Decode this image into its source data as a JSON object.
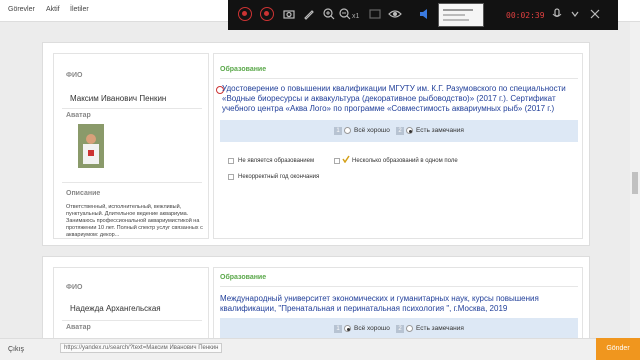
{
  "nav": {
    "tabs": [
      "Görevler",
      "Aktif",
      "İletiler"
    ]
  },
  "recorder": {
    "zoom_label": "x1",
    "timer": "00:02:39"
  },
  "cards": [
    {
      "fio_label": "ФИО",
      "name": "Максим Иванович Пенкин",
      "avatar_label": "Аватар",
      "desc_label": "Описание",
      "description": "Ответственный, исполнительный, вежливый, пунктуальный. Длительное ведение аквариума. Занимаюсь профессиональной аквариумистикой на протяжении 10 лет. Полный спектр услуг связанных с аквариумом: декор...",
      "edu_label": "Образование",
      "edu_text": "Удостоверение о повышении квалификации МГУТУ им. К.Г. Разумовского по специальности «Водные биоресурсы и аквакультура (декоративное рыбоводство)» (2017 г.). Сертификат учебного центра «Аква Лого» по программе «Совместимость аквариумных рыб» (2017 г.)",
      "opt1_num": "1",
      "opt1": "Всё хорошо",
      "opt2_num": "2",
      "opt2": "Есть замечания",
      "cb1": "Не является образованием",
      "cb2": "Несколько образований в одном поле",
      "cb3": "Некорректный год окончания"
    },
    {
      "fio_label": "ФИО",
      "name": "Надежда Архангельская",
      "avatar_label": "Аватар",
      "edu_label": "Образование",
      "edu_text": "Международный университет экономических и гуманитарных наук, курсы повышения квалификации, \"Пренатальная и перинатальная психология \", г.Москва, 2019",
      "opt1_num": "1",
      "opt1": "Всё хорошо",
      "opt2_num": "2",
      "opt2": "Есть замечания"
    }
  ],
  "footer": {
    "exit": "Çıkış",
    "url": "https://yandex.ru/search/?text=Максим Иванович Пенкин",
    "send": "Gönder"
  },
  "colors": {
    "accent": "#f0961e",
    "link": "#22409a",
    "section": "#5aa84a",
    "option_bg": "#dde8f5"
  }
}
